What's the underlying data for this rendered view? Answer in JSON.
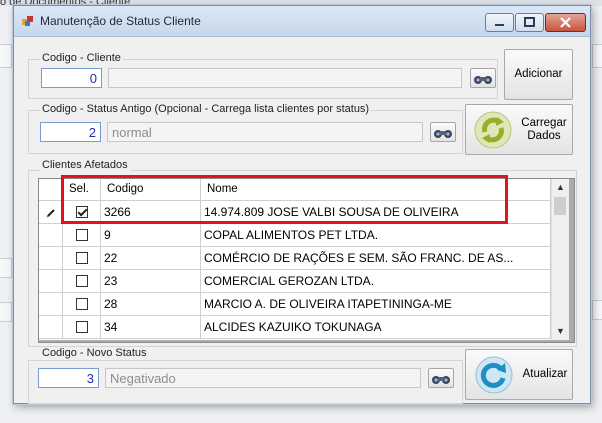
{
  "window": {
    "title": "Manutenção de Status Cliente",
    "background_partial_title": "o de Documentos - Cliente"
  },
  "cliente_group": {
    "label": "Codigo  -  Cliente",
    "code_value": "0",
    "name_value": "",
    "add_button_label": "Adicionar"
  },
  "status_antigo_group": {
    "label": "Codigo  -  Status Antigo (Opcional - Carrega lista clientes por status)",
    "code_value": "2",
    "status_value": "normal",
    "load_button_label": "Carregar Dados"
  },
  "clientes_group": {
    "label": "Clientes Afetados",
    "columns": [
      "Sel.",
      "Codigo",
      "Nome"
    ],
    "rows": [
      {
        "selected": true,
        "codigo": "3266",
        "nome": "14.974.809 JOSE VALBI SOUSA DE OLIVEIRA",
        "editing": true
      },
      {
        "selected": false,
        "codigo": "9",
        "nome": "COPAL ALIMENTOS PET LTDA."
      },
      {
        "selected": false,
        "codigo": "22",
        "nome": "COMÉRCIO DE RAÇÕES E SEM. SÃO FRANC. DE AS..."
      },
      {
        "selected": false,
        "codigo": "23",
        "nome": "COMERCIAL GEROZAN LTDA."
      },
      {
        "selected": false,
        "codigo": "28",
        "nome": "MARCIO A. DE OLIVEIRA ITAPETININGA-ME"
      },
      {
        "selected": false,
        "codigo": "34",
        "nome": "ALCIDES KAZUIKO TOKUNAGA"
      }
    ]
  },
  "novo_status_group": {
    "label": "Codigo - Novo Status",
    "code_value": "3",
    "status_value": "Negativado",
    "update_button_label": "Atualizar"
  },
  "icons": {
    "app": "app-window-icon",
    "search": "binoculars-icon",
    "load": "green-refresh-icon",
    "update": "blue-refresh-icon",
    "edit_row": "pencil-icon"
  },
  "colors": {
    "highlight": "#e0141a",
    "input_text": "#1d2fb0"
  }
}
